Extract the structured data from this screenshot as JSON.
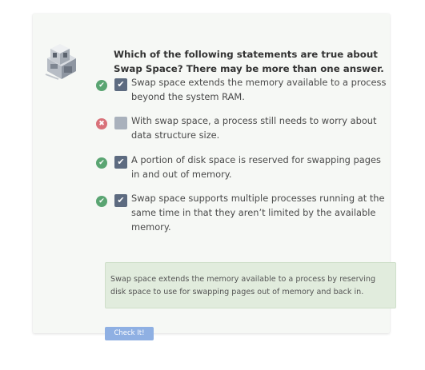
{
  "question": "Which of the following statements are true about Swap Space? There may be more than one answer.",
  "options": [
    {
      "text": "Swap space extends the memory available to a process beyond the system RAM.",
      "status_icon": "check-icon",
      "checked": true
    },
    {
      "text": "With swap space, a process still needs to worry about data structure size.",
      "status_icon": "x-icon",
      "checked": false
    },
    {
      "text": "A portion of disk space is reserved for swapping pages in and out of memory.",
      "status_icon": "check-icon",
      "checked": true
    },
    {
      "text": "Swap space supports multiple processes running at the same time in that they aren’t limited by the available memory.",
      "status_icon": "check-icon",
      "checked": true
    }
  ],
  "feedback": "Swap space extends the memory available to a process by reserving disk space to use for swapping pages out of memory and back in.",
  "check_button_label": "Check It!",
  "glyphs": {
    "check": "✔",
    "cross": "✖",
    "box_check": "✔"
  },
  "colors": {
    "correct": "#5aa572",
    "incorrect": "#d9727a",
    "checkbox": "#5d6b80",
    "button": "#8fb0e3",
    "feedback_bg": "#e1ecdd"
  }
}
